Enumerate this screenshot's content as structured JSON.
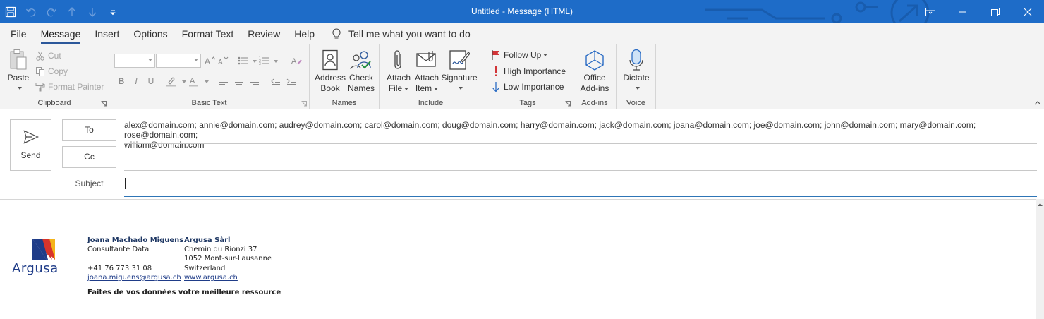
{
  "window": {
    "title": "Untitled  -  Message (HTML)"
  },
  "qat": {
    "icons": [
      "save-icon",
      "undo-icon",
      "redo-icon",
      "up-arrow-icon",
      "down-arrow-icon",
      "customize-qat-icon"
    ]
  },
  "menu": {
    "tabs": [
      "File",
      "Message",
      "Insert",
      "Options",
      "Format Text",
      "Review",
      "Help"
    ],
    "active": "Message",
    "tell_me": "Tell me what you want to do"
  },
  "ribbon": {
    "clipboard": {
      "label": "Clipboard",
      "paste": "Paste",
      "cut": "Cut",
      "copy": "Copy",
      "format_painter": "Format Painter"
    },
    "basic_text": {
      "label": "Basic Text"
    },
    "names": {
      "label": "Names",
      "address_book_1": "Address",
      "address_book_2": "Book",
      "check_names_1": "Check",
      "check_names_2": "Names"
    },
    "include": {
      "label": "Include",
      "attach_file_1": "Attach",
      "attach_file_2": "File",
      "attach_item_1": "Attach",
      "attach_item_2": "Item",
      "signature": "Signature"
    },
    "tags": {
      "label": "Tags",
      "follow_up": "Follow Up",
      "high": "High Importance",
      "low": "Low Importance"
    },
    "addins": {
      "label": "Add-ins",
      "office_1": "Office",
      "office_2": "Add-ins"
    },
    "voice": {
      "label": "Voice",
      "dictate": "Dictate"
    }
  },
  "compose": {
    "send": "Send",
    "to_label": "To",
    "cc_label": "Cc",
    "subject_label": "Subject",
    "to_line1": "alex@domain.com; annie@domain.com; audrey@domain.com; carol@domain.com; doug@domain.com; harry@domain.com; jack@domain.com; joana@domain.com; joe@domain.com; john@domain.com; mary@domain.com; rose@domain.com;",
    "to_line2": "william@domain.com",
    "cc": "",
    "subject": ""
  },
  "signature": {
    "logo_text": "Argusa",
    "name": "Joana Machado Miguens",
    "role": "Consultante Data",
    "phone": "+41 76 773 31 08",
    "email": "joana.miguens@argusa.ch",
    "company": "Argusa Sàrl",
    "street": "Chemin du Rionzi 37",
    "city": "1052 Mont-sur-Lausanne",
    "country": "Switzerland",
    "website": "www.argusa.ch",
    "tagline": "Faites de vos données votre meilleure ressource"
  },
  "colors": {
    "titlebar": "#1e6cc8",
    "accent": "#2b579a",
    "logo_blue": "#1f3c88",
    "logo_red": "#d8342b",
    "logo_yellow": "#f4b41a"
  }
}
